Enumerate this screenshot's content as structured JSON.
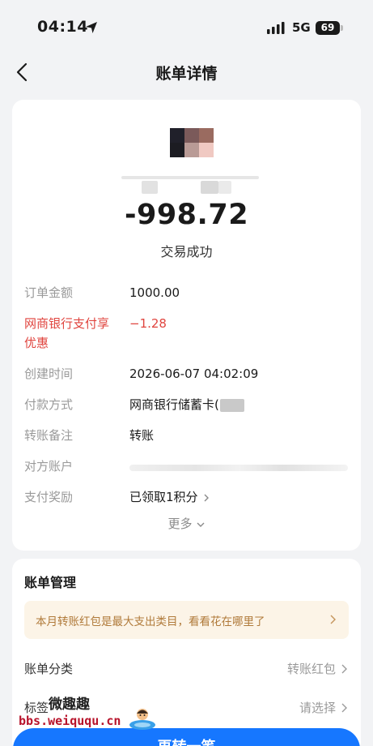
{
  "status_bar": {
    "time": "04:14",
    "network": "5G",
    "battery": "69"
  },
  "nav": {
    "title": "账单详情"
  },
  "transaction": {
    "amount": "-998.72",
    "status": "交易成功"
  },
  "details": [
    {
      "label": "订单金额",
      "value": "1000.00"
    },
    {
      "label": "网商银行支付享优惠",
      "value": "−1.28"
    },
    {
      "label": "创建时间",
      "value": "2026-06-07 04:02:09"
    },
    {
      "label": "付款方式",
      "value": "网商银行储蓄卡("
    },
    {
      "label": "转账备注",
      "value": "转账"
    },
    {
      "label": "对方账户",
      "value": ""
    },
    {
      "label": "支付奖励",
      "value": "已领取1积分"
    }
  ],
  "more": "更多",
  "management": {
    "title": "账单管理",
    "tip": "本月转账红包是最大支出类目，看看花在哪里了",
    "category_label": "账单分类",
    "category_value": "转账红包",
    "tag_label": "标签",
    "tag_value": "请选择"
  },
  "watermark": {
    "title": "微趣趣",
    "url": "bbs.weiququ.cn"
  },
  "bottom_button": "再转一笔",
  "colors": {
    "accent": "#1677ff",
    "discount": "#e0453f",
    "tip_bg": "#fcf4e7",
    "tip_text": "#b07a3a"
  },
  "icons": [
    "location-arrow-icon",
    "signal-icon",
    "battery-icon",
    "back-arrow-icon",
    "chevron-right-icon",
    "chevron-down-icon"
  ]
}
